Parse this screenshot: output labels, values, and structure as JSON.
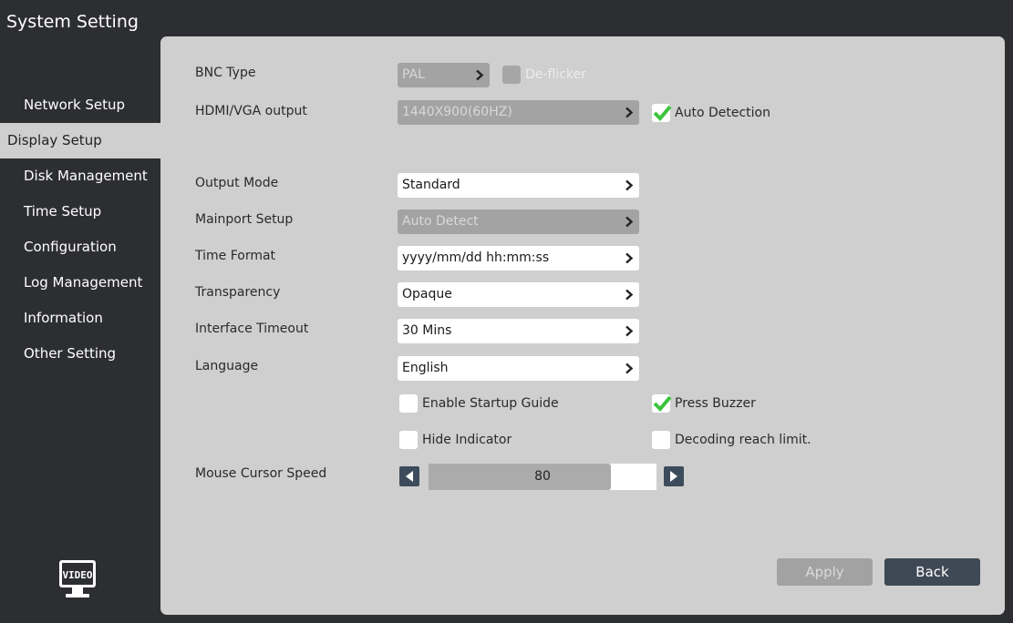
{
  "window": {
    "title": "System Setting"
  },
  "sidebar": {
    "items": [
      {
        "label": "Network Setup"
      },
      {
        "label": "Display Setup"
      },
      {
        "label": "Disk Management"
      },
      {
        "label": "Time Setup"
      },
      {
        "label": "Configuration"
      },
      {
        "label": "Log Management"
      },
      {
        "label": "Information"
      },
      {
        "label": "Other Setting"
      }
    ],
    "active_index": 1,
    "logo_text": "VIDEO"
  },
  "form": {
    "bnc_type": {
      "label": "BNC Type",
      "value": "PAL",
      "enabled": false
    },
    "deflicker": {
      "label": "De-flicker",
      "checked": false,
      "enabled": false
    },
    "hdmi_vga": {
      "label": "HDMI/VGA output",
      "value": "1440X900(60HZ)",
      "enabled": false
    },
    "auto_detection": {
      "label": "Auto Detection",
      "checked": true
    },
    "output_mode": {
      "label": "Output Mode",
      "value": "Standard"
    },
    "mainport": {
      "label": "Mainport Setup",
      "value": "Auto Detect",
      "enabled": false
    },
    "time_format": {
      "label": "Time Format",
      "value": "yyyy/mm/dd hh:mm:ss"
    },
    "transparency": {
      "label": "Transparency",
      "value": "Opaque"
    },
    "interface_timeout": {
      "label": "Interface Timeout",
      "value": "30 Mins"
    },
    "language": {
      "label": "Language",
      "value": "English"
    },
    "enable_startup_guide": {
      "label": "Enable Startup Guide",
      "checked": false
    },
    "press_buzzer": {
      "label": "Press Buzzer",
      "checked": true
    },
    "hide_indicator": {
      "label": "Hide Indicator",
      "checked": false
    },
    "decoding_limit": {
      "label": "Decoding reach limit.",
      "checked": false
    },
    "mouse_speed": {
      "label": "Mouse Cursor Speed",
      "value": "80",
      "fraction": 0.8
    }
  },
  "buttons": {
    "apply": "Apply",
    "back": "Back"
  },
  "colors": {
    "background": "#2d2e32",
    "panel": "#cfcfcf",
    "check_green": "#3cc43c",
    "back_button": "#3f4955",
    "slider_button": "#3d4c5c"
  }
}
